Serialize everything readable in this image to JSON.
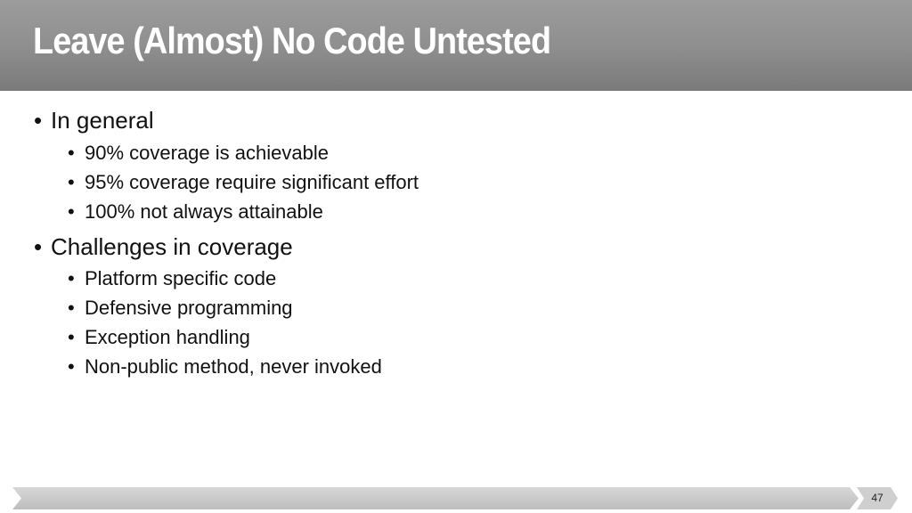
{
  "slide": {
    "title": "Leave (Almost) No Code Untested",
    "bullet_glyph": "•",
    "sections": [
      {
        "heading": "In general",
        "items": [
          "90% coverage is achievable",
          "95% coverage require significant effort",
          "100% not always attainable"
        ]
      },
      {
        "heading": "Challenges in coverage",
        "items": [
          "Platform specific code",
          "Defensive programming",
          "Exception handling",
          "Non-public method, never invoked"
        ]
      }
    ],
    "page_number": "47"
  }
}
